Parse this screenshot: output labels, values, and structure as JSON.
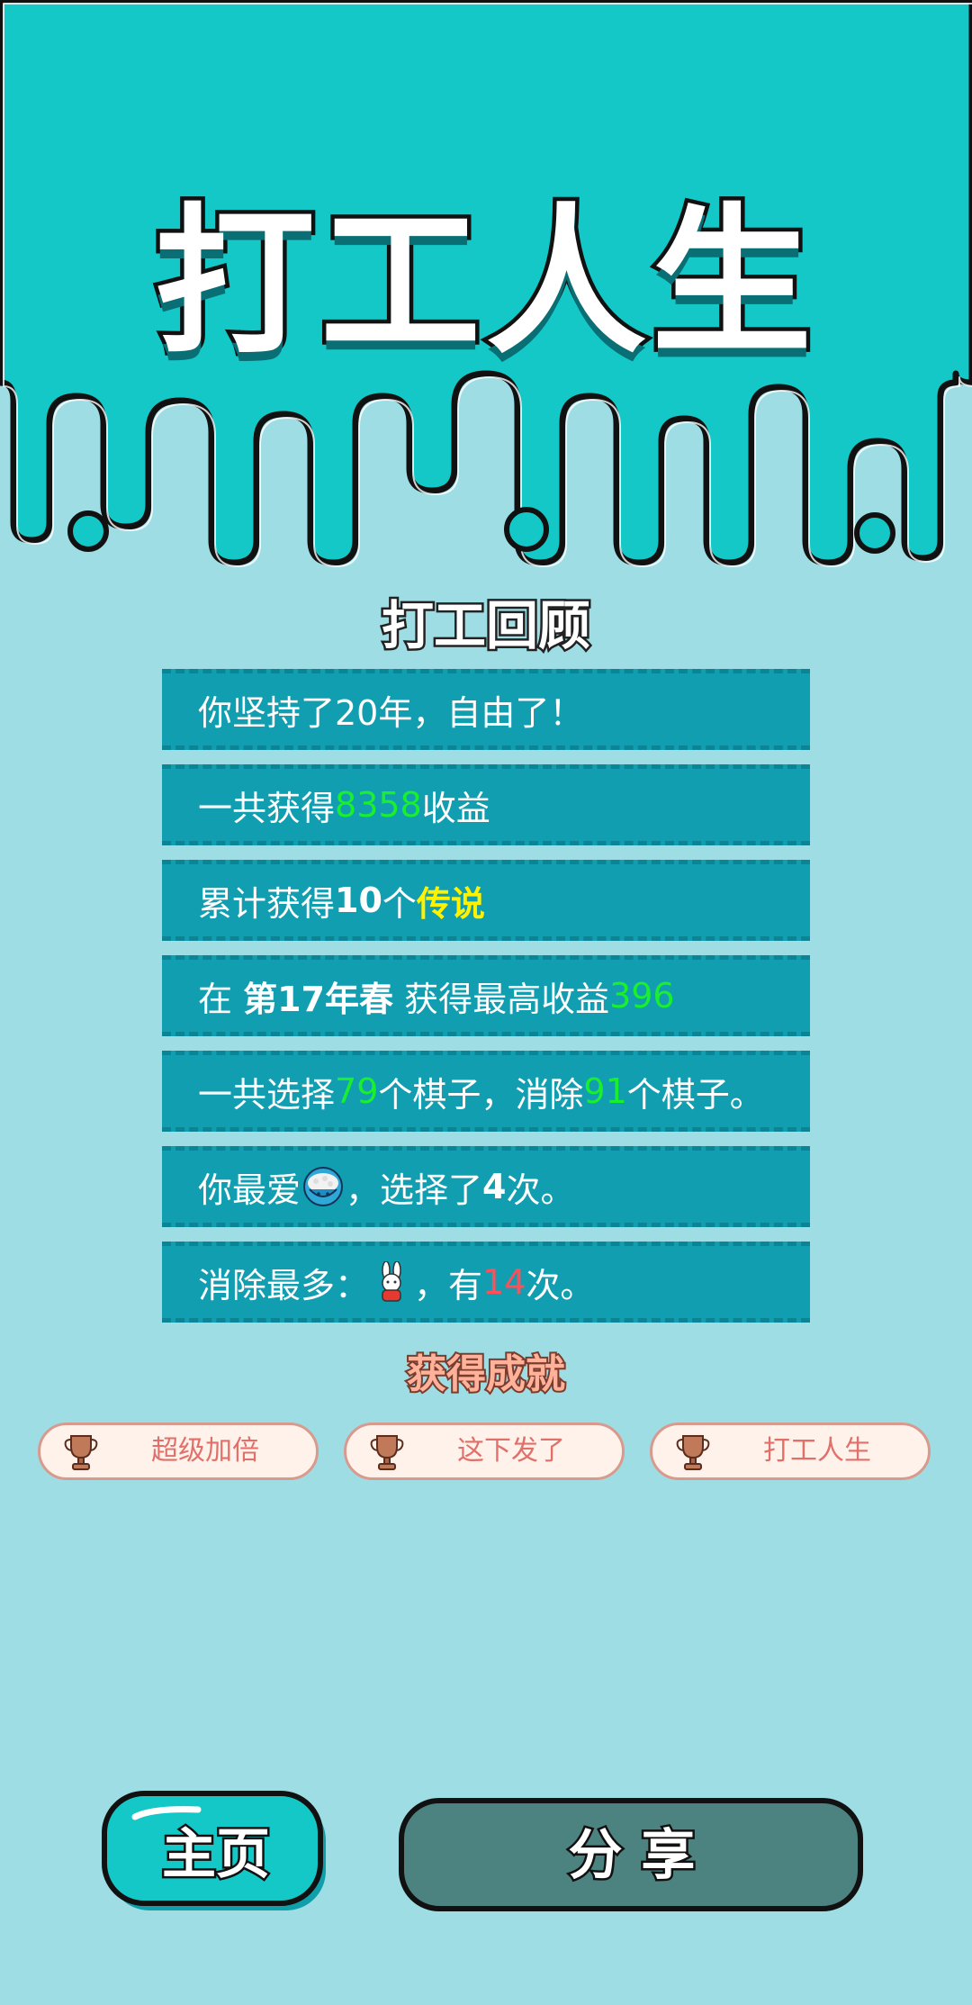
{
  "app": {
    "title": "打工人生"
  },
  "review": {
    "title": "打工回顾",
    "row1": {
      "text": "你坚持了20年，自由了！"
    },
    "row2": {
      "pre": "一共获得",
      "value": "8358",
      "post": "收益"
    },
    "row3": {
      "pre": "累计获得",
      "count": "10",
      "mid": "个",
      "highlight": "传说"
    },
    "row4": {
      "pre": "在 ",
      "season": "第17年春",
      "mid": " 获得最高收益",
      "value": "396"
    },
    "row5": {
      "pre": "一共选择",
      "chosen": "79",
      "mid": "个棋子，消除",
      "removed": "91",
      "post": "个棋子。"
    },
    "row6": {
      "pre": "你最爱",
      "mid": "，选择了",
      "count": "4",
      "post": "次。"
    },
    "row7": {
      "pre": "消除最多：",
      "mid": "，有",
      "count": "14",
      "post": "次。"
    }
  },
  "achievements": {
    "title": "获得成就",
    "items": [
      {
        "label": "超级加倍",
        "icon": "trophy-icon"
      },
      {
        "label": "这下发了",
        "icon": "trophy-icon"
      },
      {
        "label": "打工人生",
        "icon": "trophy-icon"
      }
    ]
  },
  "buttons": {
    "home": "主页",
    "share": "分 享"
  },
  "colors": {
    "header": "#15c8c8",
    "background": "#9fdde4",
    "row": "#129eb1",
    "green": "#19ef2e",
    "yellow": "#fff200",
    "red": "#ff4f58",
    "share_button": "#4c8280"
  }
}
